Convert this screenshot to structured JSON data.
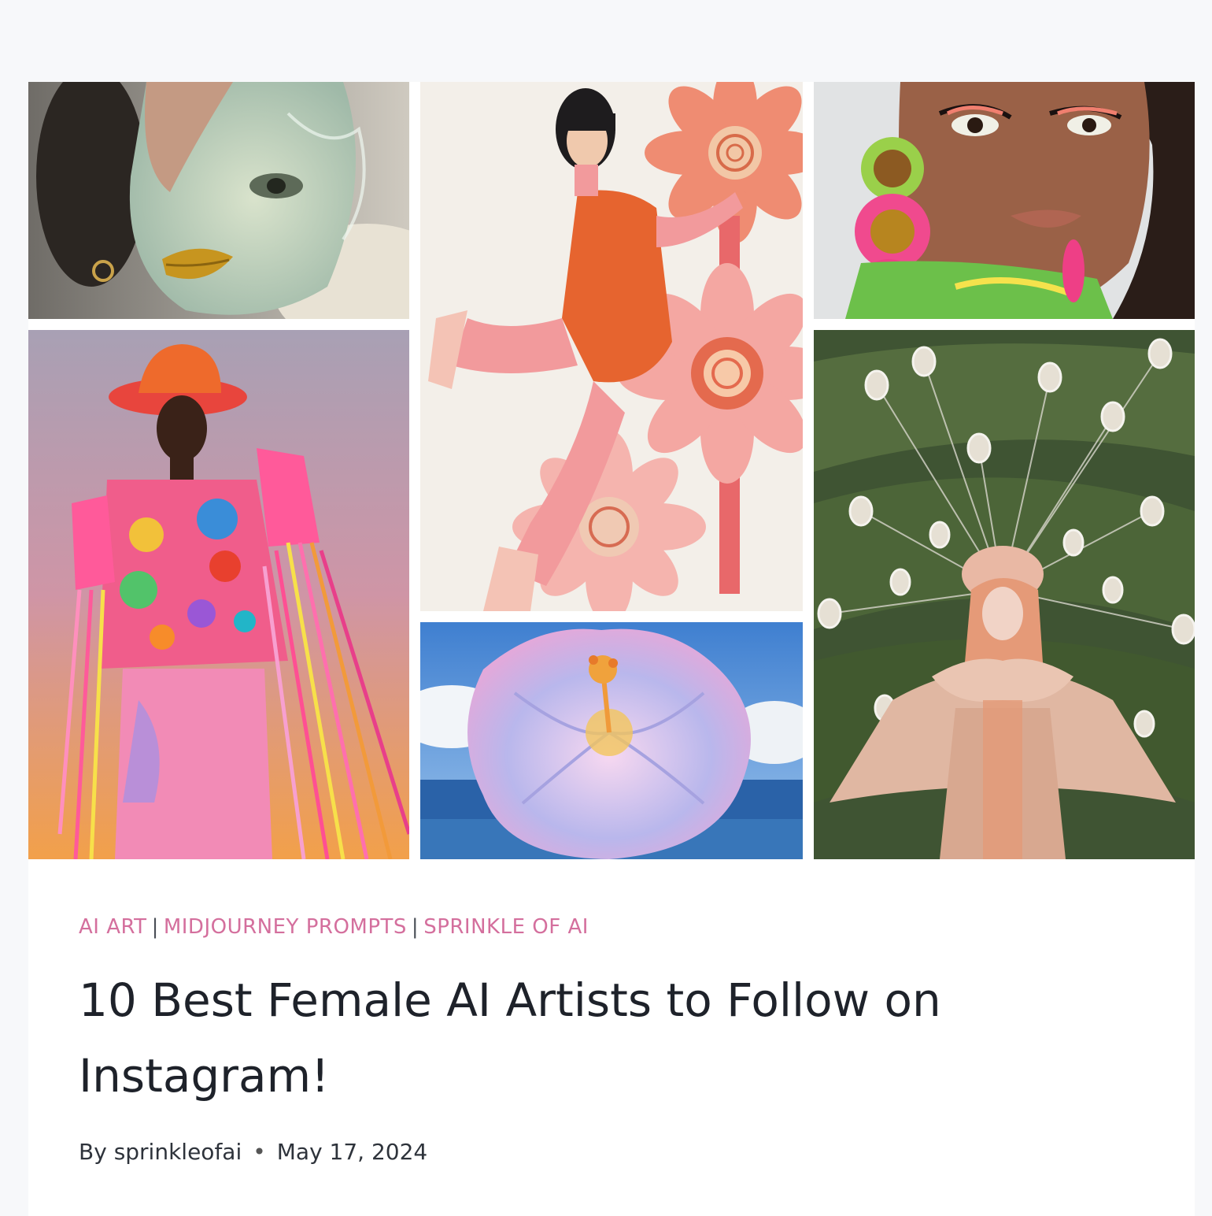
{
  "post": {
    "categories": [
      "AI ART",
      "MIDJOURNEY PROMPTS",
      "SPRINKLE OF AI"
    ],
    "category_separator": "|",
    "title": "10 Best Female AI Artists to Follow on Instagram!",
    "by_label": "By",
    "author": "sprinkleofai",
    "meta_separator": "•",
    "date": "May 17, 2024"
  },
  "colors": {
    "page_bg": "#f7f8fa",
    "category_pink": "#d46f9d",
    "title_text": "#1e222a"
  },
  "gallery": [
    {
      "name": "mint-glossy-face-closeup"
    },
    {
      "name": "pink-figure-with-flowers"
    },
    {
      "name": "beaded-earrings-portrait"
    },
    {
      "name": "fringed-colorful-jacket-model"
    },
    {
      "name": "iridescent-hibiscus-over-sea"
    },
    {
      "name": "woman-with-floating-face-ornaments"
    }
  ]
}
